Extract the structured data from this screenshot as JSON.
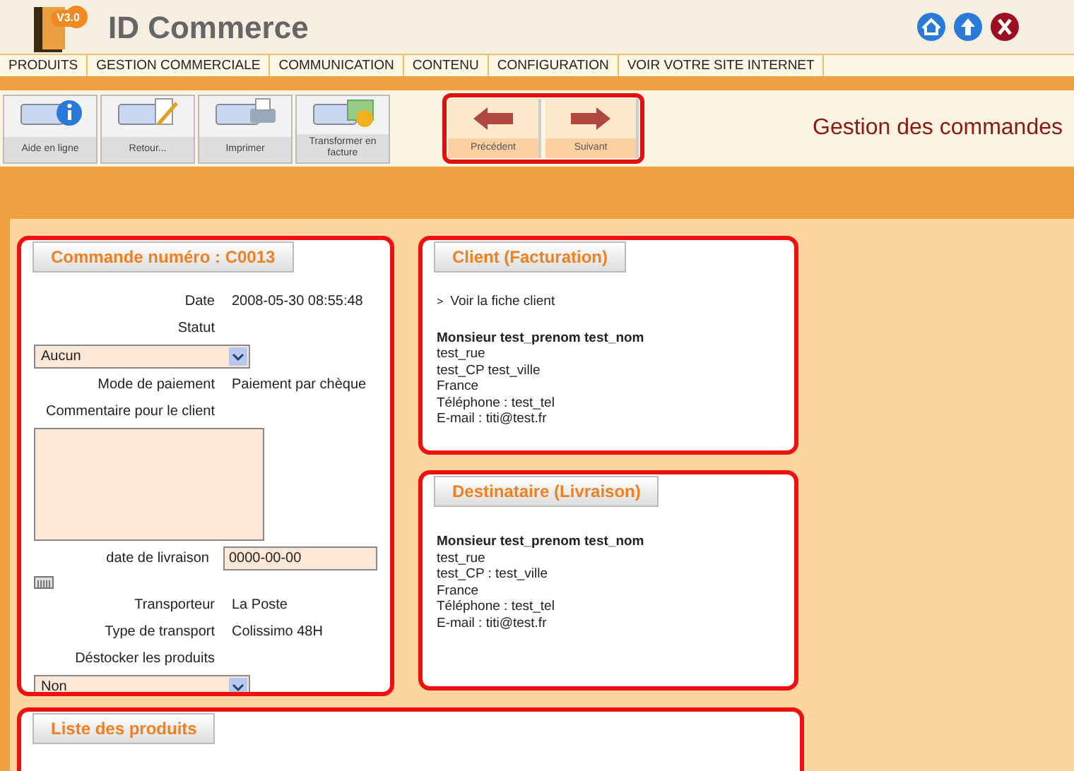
{
  "app": {
    "title": "ID Commerce",
    "version": "V3.0"
  },
  "menu": [
    {
      "label": "PRODUITS"
    },
    {
      "label": "GESTION COMMERCIALE"
    },
    {
      "label": "COMMUNICATION"
    },
    {
      "label": "CONTENU"
    },
    {
      "label": "CONFIGURATION"
    },
    {
      "label": "VOIR VOTRE SITE INTERNET"
    }
  ],
  "toolbar": [
    {
      "label": "Aide en ligne",
      "kind": "help"
    },
    {
      "label": "Retour...",
      "kind": "edit"
    },
    {
      "label": "Imprimer",
      "kind": "print"
    },
    {
      "label": "Transformer en facture",
      "kind": "invoice"
    }
  ],
  "nav_buttons": [
    {
      "label": "Précédent",
      "kind": "prev"
    },
    {
      "label": "Suivant",
      "kind": "next"
    }
  ],
  "page_title": "Gestion des commandes",
  "order": {
    "title": "Commande numéro : C0013",
    "fields": [
      {
        "kind": "text",
        "label": "Date",
        "value": "2008-05-30 08:55:48"
      },
      {
        "kind": "select",
        "label": "Statut",
        "value": "Aucun"
      },
      {
        "kind": "text",
        "label": "Mode de paiement",
        "value": "Paiement par chèque"
      },
      {
        "kind": "textarea",
        "label": "Commentaire pour le client"
      },
      {
        "kind": "date",
        "label": "date de livraison",
        "value": "0000-00-00"
      },
      {
        "kind": "text",
        "label": "Transporteur",
        "value": "La Poste"
      },
      {
        "kind": "text",
        "label": "Type de transport",
        "value": "Colissimo 48H"
      },
      {
        "kind": "select",
        "label": "Déstocker les produits",
        "value": "Non"
      }
    ]
  },
  "client": {
    "title": "Client (Facturation)",
    "link_marker": ">",
    "link": "Voir la fiche client",
    "lines": [
      "Monsieur test_prenom test_nom",
      "test_rue",
      "test_CP test_ville",
      "France",
      "Téléphone : test_tel",
      "E-mail : titi@test.fr"
    ]
  },
  "recipient": {
    "title": "Destinataire (Livraison)",
    "lines": [
      "Monsieur test_prenom test_nom",
      "test_rue",
      "test_CP : test_ville",
      "France",
      "Téléphone : test_tel",
      "E-mail : titi@test.fr"
    ]
  },
  "products": {
    "title": "Liste des produits"
  }
}
